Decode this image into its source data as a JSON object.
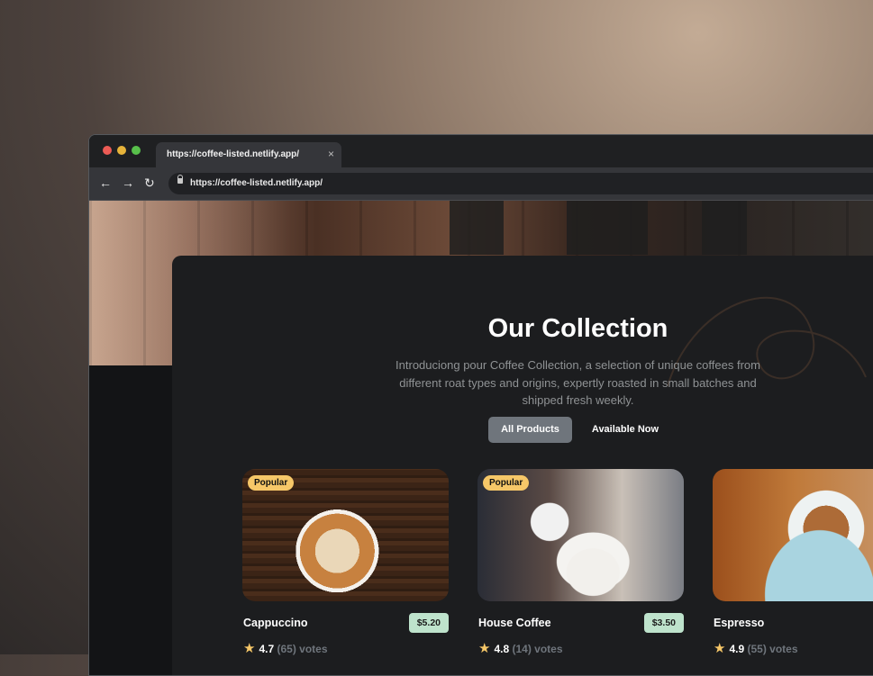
{
  "browser": {
    "tab_title": "https://coffee-listed.netlify.app/",
    "tab_close": "×",
    "url": "https://coffee-listed.netlify.app/",
    "icons": {
      "back": "←",
      "forward": "→",
      "reload": "↻"
    }
  },
  "collection": {
    "heading": "Our Collection",
    "description": "Introduciong pour Coffee Collection, a selection of unique coffees from different roat types and origins, expertly roasted in small batches and shipped fresh weekly.",
    "filters": [
      {
        "label": "All Products",
        "active": true
      },
      {
        "label": "Available Now",
        "active": false
      }
    ]
  },
  "products": [
    {
      "name": "Cappuccino",
      "price": "$5.20",
      "badge": "Popular",
      "rating": "4.7",
      "votes": "(65) votes"
    },
    {
      "name": "House Coffee",
      "price": "$3.50",
      "badge": "Popular",
      "rating": "4.8",
      "votes": "(14) votes"
    },
    {
      "name": "Espresso",
      "price": "",
      "badge": "",
      "rating": "4.9",
      "votes": "(55) votes"
    }
  ],
  "colors": {
    "accent_badge": "#f6c768",
    "price_tag": "#bee3cc",
    "active_filter": "#6f757c",
    "panel": "#1c1d1f"
  }
}
